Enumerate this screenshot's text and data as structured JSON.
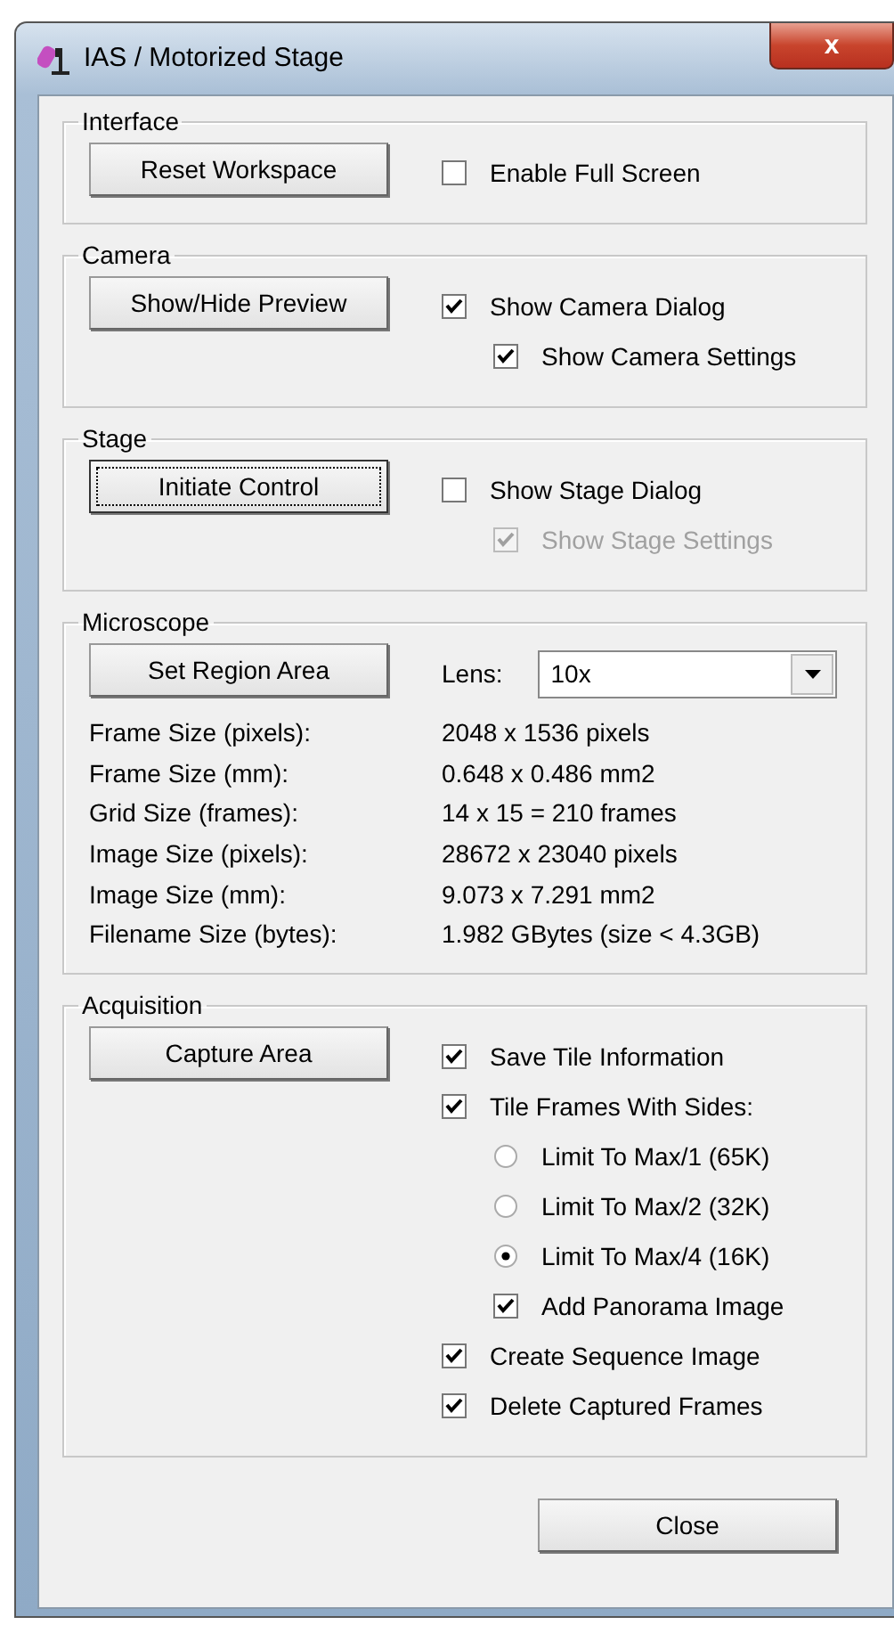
{
  "window": {
    "title": "IAS / Motorized Stage",
    "close_glyph": "x"
  },
  "sections": [
    {
      "kind": "options",
      "title": "Interface",
      "button": {
        "label": "Reset Workspace",
        "focused": false
      },
      "options": [
        {
          "kind": "checkbox",
          "label": "Enable Full Screen",
          "checked": false,
          "disabled": false
        }
      ]
    },
    {
      "kind": "options",
      "title": "Camera",
      "button": {
        "label": "Show/Hide Preview",
        "focused": false
      },
      "options": [
        {
          "kind": "checkbox",
          "label": "Show Camera Dialog",
          "checked": true,
          "disabled": false,
          "children": [
            {
              "kind": "checkbox",
              "label": "Show Camera Settings",
              "checked": true,
              "disabled": false
            }
          ]
        }
      ]
    },
    {
      "kind": "options",
      "title": "Stage",
      "button": {
        "label": "Initiate Control",
        "focused": true
      },
      "options": [
        {
          "kind": "checkbox",
          "label": "Show Stage Dialog",
          "checked": false,
          "disabled": false,
          "children": [
            {
              "kind": "checkbox",
              "label": "Show Stage Settings",
              "checked": true,
              "disabled": true
            }
          ]
        }
      ]
    },
    {
      "kind": "info",
      "title": "Microscope",
      "button": {
        "label": "Set Region Area",
        "focused": false
      },
      "lens": {
        "label": "Lens:",
        "value": "10x"
      },
      "rows": [
        {
          "label": "Frame Size (pixels):",
          "value": "2048 x 1536 pixels"
        },
        {
          "label": "Frame Size (mm):",
          "value": "0.648 x 0.486 mm2"
        },
        {
          "label": "Grid Size (frames):",
          "value": "14 x 15 = 210 frames"
        },
        {
          "label": "Image Size (pixels):",
          "value": "28672 x 23040 pixels"
        },
        {
          "label": "Image Size (mm):",
          "value": "9.073 x 7.291 mm2"
        },
        {
          "label": "Filename Size (bytes):",
          "value": "1.982 GBytes (size < 4.3GB)"
        }
      ]
    },
    {
      "kind": "options",
      "title": "Acquisition",
      "button": {
        "label": "Capture Area",
        "focused": false
      },
      "options": [
        {
          "kind": "checkbox",
          "label": "Save Tile Information",
          "checked": true,
          "disabled": false
        },
        {
          "kind": "checkbox",
          "label": "Tile Frames With Sides:",
          "checked": true,
          "disabled": false,
          "children": [
            {
              "kind": "radio",
              "label": "Limit To Max/1 (65K)",
              "selected": false,
              "disabled": false
            },
            {
              "kind": "radio",
              "label": "Limit To Max/2 (32K)",
              "selected": false,
              "disabled": false
            },
            {
              "kind": "radio",
              "label": "Limit To Max/4 (16K)",
              "selected": true,
              "disabled": false
            },
            {
              "kind": "checkbox",
              "label": "Add Panorama Image",
              "checked": true,
              "disabled": false
            }
          ]
        },
        {
          "kind": "checkbox",
          "label": "Create Sequence Image",
          "checked": true,
          "disabled": false
        },
        {
          "kind": "checkbox",
          "label": "Delete Captured Frames",
          "checked": true,
          "disabled": false
        }
      ]
    }
  ],
  "close_button": {
    "label": "Close"
  }
}
